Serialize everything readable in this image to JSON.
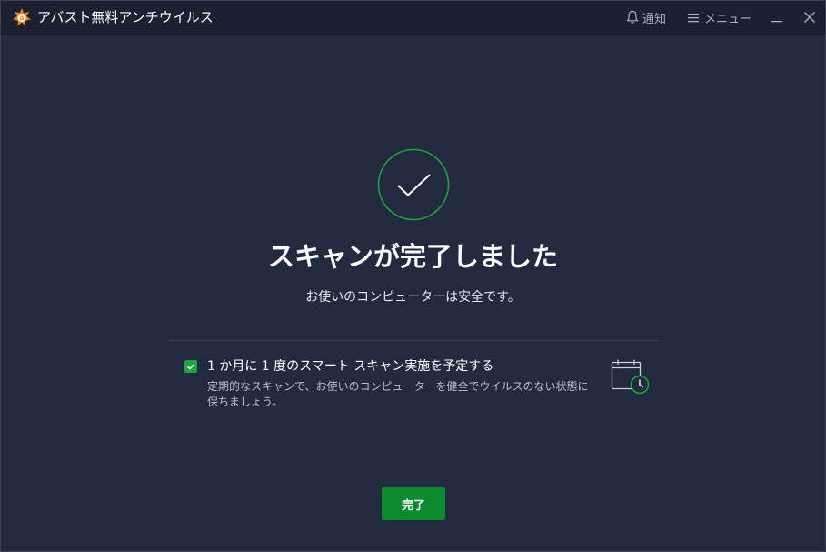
{
  "titlebar": {
    "app_title": "アバスト無料アンチウイルス",
    "notify_label": "通知",
    "menu_label": "メニュー"
  },
  "main": {
    "headline": "スキャンが完了しました",
    "subline": "お使いのコンピューターは安全です。",
    "schedule": {
      "checked": true,
      "label": "1 か月に 1 度のスマート スキャン実施を予定する",
      "description": "定期的なスキャンで、お使いのコンピューターを健全でウイルスのない状態に保ちましょう。"
    },
    "done_label": "完了"
  },
  "colors": {
    "background": "#222a40",
    "titlebar": "#1b2133",
    "accent_green": "#1aa63a",
    "button_green": "#0c8b2c",
    "brand_orange": "#ff7800"
  },
  "icons": [
    "avast-logo-icon",
    "bell-icon",
    "hamburger-icon",
    "minimize-icon",
    "close-icon",
    "checkmark-circle-icon",
    "checkbox-check-icon",
    "calendar-clock-icon"
  ]
}
